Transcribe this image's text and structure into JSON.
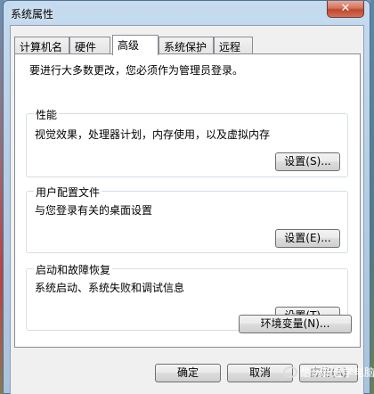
{
  "window": {
    "title": "系统属性",
    "close_glyph": "✕"
  },
  "tabs": [
    {
      "label": "计算机名",
      "active": false
    },
    {
      "label": "硬件",
      "active": false
    },
    {
      "label": "高级",
      "active": true
    },
    {
      "label": "系统保护",
      "active": false
    },
    {
      "label": "远程",
      "active": false
    }
  ],
  "notice": "要进行大多数更改，您必须作为管理员登录。",
  "groups": {
    "performance": {
      "title": "性能",
      "desc": "视觉效果，处理器计划，内存使用，以及虚拟内存",
      "button": "设置(S)..."
    },
    "profiles": {
      "title": "用户配置文件",
      "desc": "与您登录有关的桌面设置",
      "button": "设置(E)..."
    },
    "startup": {
      "title": "启动和故障恢复",
      "desc": "系统启动、系统失败和调试信息",
      "button": "设置(T)..."
    }
  },
  "env_button": "环境变量(N)...",
  "footer": {
    "ok": "确定",
    "cancel": "取消",
    "apply": "应用(A)"
  },
  "watermark": "酷玩新进学电脑",
  "icons": {
    "close": "close-icon",
    "watermark": "wechat-icon"
  }
}
